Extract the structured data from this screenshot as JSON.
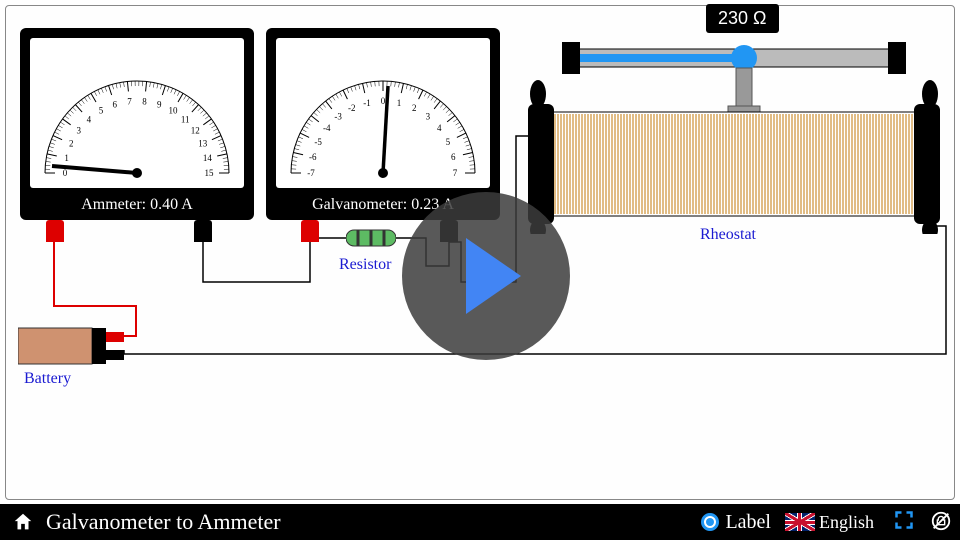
{
  "title": "Galvanometer to Ammeter",
  "ammeter": {
    "label": "Ammeter: 0.40 A",
    "min": 0,
    "max": 15,
    "value": 0.4
  },
  "galvanometer": {
    "label": "Galvanometer: 0.23 A",
    "min": -7,
    "max": 7,
    "value": 0.23
  },
  "rheostat": {
    "resistance": "230 Ω",
    "label": "Rheostat"
  },
  "resistor": {
    "label": "Resistor"
  },
  "battery": {
    "label": "Battery"
  },
  "controls": {
    "label_toggle": "Label",
    "language": "English"
  }
}
